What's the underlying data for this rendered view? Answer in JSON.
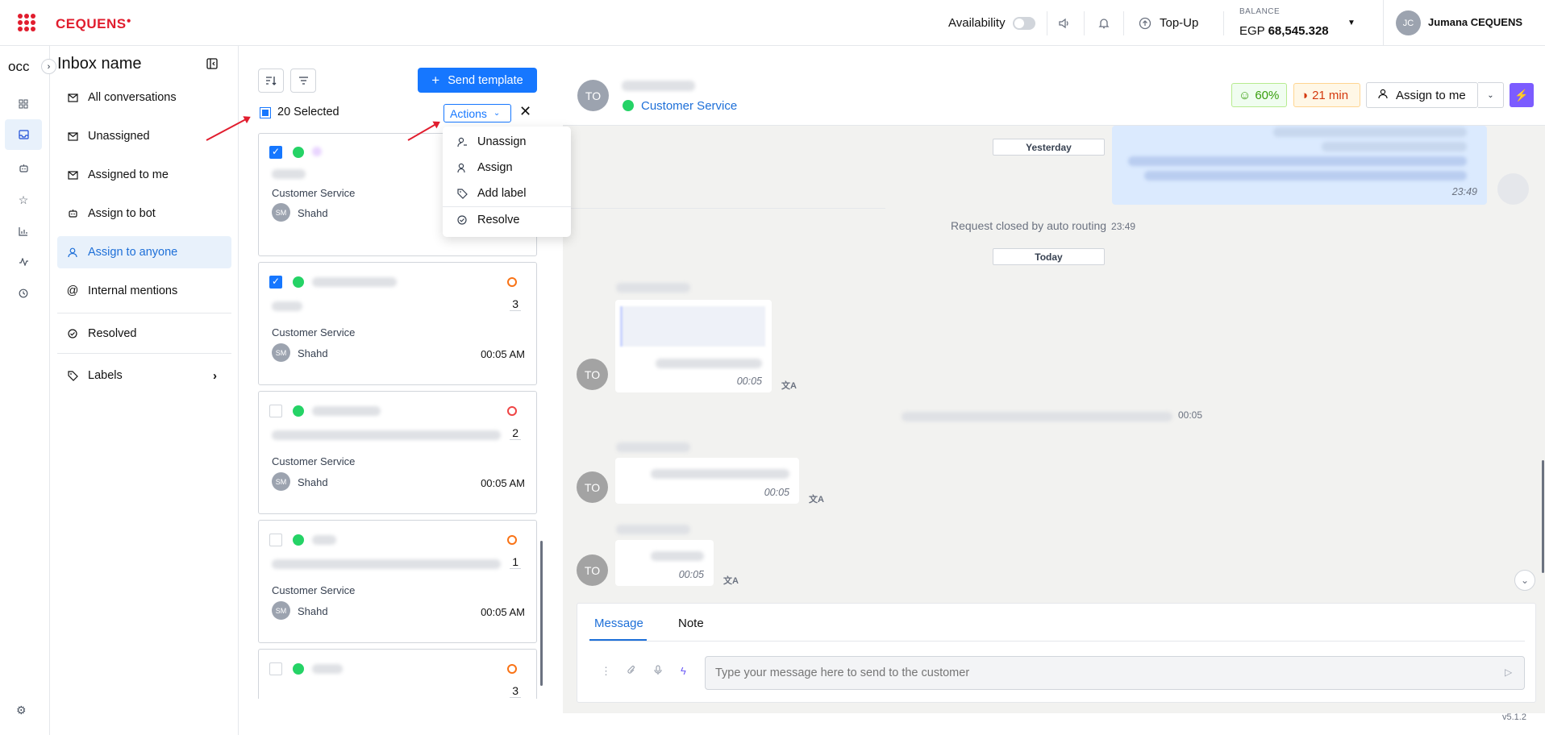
{
  "brand": {
    "name": "CEQUENS",
    "color": "#e11d2e"
  },
  "topbar": {
    "availability_label": "Availability",
    "topup_label": "Top-Up",
    "balance_label": "BALANCE",
    "balance_currency": "EGP",
    "balance_amount": "68,545.328",
    "user_initials": "JC",
    "user_name": "Jumana CEQUENS"
  },
  "rail": {
    "workspace": "occ",
    "icons": [
      "dashboard-icon",
      "inbox-icon",
      "bot-icon",
      "star-icon",
      "chart-icon",
      "activity-icon",
      "history-icon",
      "settings-icon"
    ]
  },
  "inbox": {
    "title": "Inbox name",
    "items": [
      {
        "label": "All conversations",
        "icon": "mail-icon"
      },
      {
        "label": "Unassigned",
        "icon": "mail-plus-icon"
      },
      {
        "label": "Assigned to me",
        "icon": "mail-check-icon"
      },
      {
        "label": "Assign to bot",
        "icon": "bot-icon"
      },
      {
        "label": "Assign to anyone",
        "icon": "user-icon",
        "active": true
      },
      {
        "label": "Internal mentions",
        "icon": "at-icon"
      },
      {
        "label": "Resolved",
        "icon": "check-circle-icon"
      },
      {
        "label": "Labels",
        "icon": "tag-icon"
      }
    ]
  },
  "list": {
    "send_template_label": "Send template",
    "selected_text": "20 Selected",
    "actions_label": "Actions",
    "cards": [
      {
        "checked": true,
        "team": "Customer Service",
        "agent": "Shahd",
        "agent_initials": "SM",
        "time": "",
        "count": ""
      },
      {
        "checked": true,
        "team": "Customer Service",
        "agent": "Shahd",
        "agent_initials": "SM",
        "time": "00:05 AM",
        "count": "3"
      },
      {
        "checked": false,
        "team": "Customer Service",
        "agent": "Shahd",
        "agent_initials": "SM",
        "time": "00:05 AM",
        "count": "2"
      },
      {
        "checked": false,
        "team": "Customer Service",
        "agent": "Shahd",
        "agent_initials": "SM",
        "time": "00:05 AM",
        "count": "1"
      },
      {
        "checked": false,
        "team": "",
        "agent": "",
        "agent_initials": "",
        "time": "",
        "count": "3"
      }
    ]
  },
  "actions_menu": {
    "items": [
      {
        "label": "Unassign",
        "icon": "user-minus-icon"
      },
      {
        "label": "Assign",
        "icon": "user-icon"
      },
      {
        "label": "Add label",
        "icon": "tag-icon"
      },
      {
        "label": "Resolve",
        "icon": "check-circle-icon"
      }
    ]
  },
  "chat": {
    "contact_initials": "TO",
    "team": "Customer Service",
    "sla_percent": "60%",
    "sla_time": "21 min",
    "assign_label": "Assign to me",
    "day_yesterday": "Yesterday",
    "day_today": "Today",
    "out_time": "23:49",
    "system_closed": "Request closed by auto routing",
    "system_closed_time": "23:49",
    "system_assign_time": "00:05",
    "messages": [
      {
        "time": "00:05"
      },
      {
        "time": "00:05"
      },
      {
        "time": "00:05"
      }
    ],
    "composer": {
      "tab_message": "Message",
      "tab_note": "Note",
      "placeholder": "Type your message here to send to the customer"
    }
  },
  "version": "v5.1.2"
}
